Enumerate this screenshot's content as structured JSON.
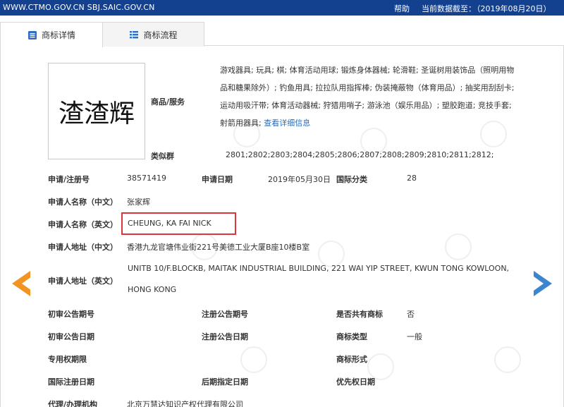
{
  "topbar": {
    "site": "WWW.CTMO.GOV.CN SBJ.SAIC.GOV.CN",
    "help": "帮助",
    "date_label": "当前数据截至：",
    "date_value": "（2019年08月20日）"
  },
  "tabs": [
    {
      "label": "商标详情",
      "icon": "document-icon",
      "active": true
    },
    {
      "label": "商标流程",
      "icon": "list-icon",
      "active": false
    }
  ],
  "mark": {
    "text": "渣渣辉"
  },
  "goods": {
    "label": "商品/服务",
    "text": "游戏器具; 玩具; 棋; 体育活动用球; 锻炼身体器械; 轮滑鞋; 圣诞树用装饰品（照明用物品和糖果除外）; 钓鱼用具; 拉拉队用指挥棒; 伪装掩蔽物（体育用品）; 抽奖用刮刮卡; 运动用吸汗带; 体育活动器械; 狩猎用哨子; 游泳池（娱乐用品）; 塑胶跑道; 竞技手套; 射箭用器具;",
    "link": "查看详细信息"
  },
  "similar_group": {
    "label": "类似群",
    "value": "2801;2802;2803;2804;2805;2806;2807;2808;2809;2810;2811;2812;"
  },
  "fields": {
    "reg_no_label": "申请/注册号",
    "reg_no": "38571419",
    "app_date_label": "申请日期",
    "app_date": "2019年05月30日",
    "intl_class_label": "国际分类",
    "intl_class": "28",
    "applicant_cn_label": "申请人名称（中文）",
    "applicant_cn": "张家辉",
    "applicant_en_label": "申请人名称（英文）",
    "applicant_en": "CHEUNG, KA FAI NICK",
    "address_cn_label": "申请人地址（中文）",
    "address_cn": "香港九龙官塘伟业街221号美德工业大厦B座10楼B室",
    "address_en_label": "申请人地址（英文）",
    "address_en_1": "UNITB 10/F.BLOCKB, MAITAK INDUSTRIAL BUILDING, 221 WAI YIP STREET, KWUN TONG KOWLOON,",
    "address_en_2": "HONG KONG",
    "prelim_no_label": "初审公告期号",
    "reg_notice_no_label": "注册公告期号",
    "shared_label": "是否共有商标",
    "shared": "否",
    "prelim_date_label": "初审公告日期",
    "reg_notice_date_label": "注册公告日期",
    "mark_type_label": "商标类型",
    "mark_type": "一般",
    "exclusive_period_label": "专用权期限",
    "mark_form_label": "商标形式",
    "intl_reg_date_label": "国际注册日期",
    "later_date_label": "后期指定日期",
    "priority_date_label": "优先权日期",
    "agent_label": "代理/办理机构",
    "agent": "北京万慧达知识产权代理有限公司"
  },
  "colors": {
    "topbar": "#14418f",
    "highlight": "#d9363e",
    "prev_arrow": "#f29422",
    "next_arrow": "#3b86cf",
    "link": "#2a6ebb"
  }
}
